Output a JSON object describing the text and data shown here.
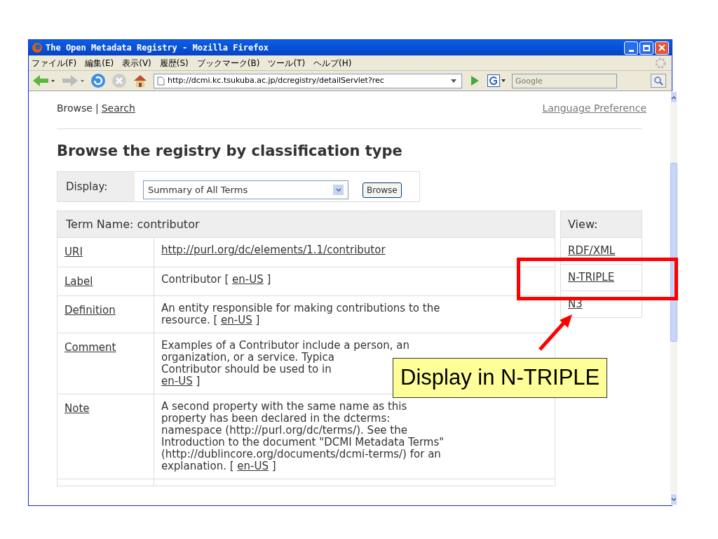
{
  "window": {
    "title": "The Open Metadata Registry - Mozilla Firefox"
  },
  "menu": [
    "ファイル(F)",
    "編集(E)",
    "表示(V)",
    "履歴(S)",
    "ブックマーク(B)",
    "ツール(T)",
    "ヘルプ(H)"
  ],
  "toolbar": {
    "url": "http://dcmi.kc.tsukuba.ac.jp/dcregistry/detailServlet?rec",
    "search_placeholder": "Google"
  },
  "nav": {
    "links": [
      {
        "text": "Browse",
        "link": false
      },
      {
        "text": "Search",
        "link": true
      }
    ],
    "separator": "|",
    "language": "Language Preference"
  },
  "heading": "Browse the registry by classification type",
  "display": {
    "label": "Display:",
    "value": "Summary of All Terms",
    "button": "Browse"
  },
  "table": {
    "header": "Term Name: contributor",
    "rows": [
      {
        "name": "URI",
        "lines": [
          [
            {
              "kind": "link",
              "text": "http://purl.org/dc/elements/1.1/contributor"
            }
          ]
        ]
      },
      {
        "name": "Label",
        "lines": [
          [
            {
              "kind": "text",
              "text": "Contributor [ "
            },
            {
              "kind": "link",
              "text": "en-US"
            },
            {
              "kind": "text",
              "text": " ]"
            }
          ]
        ]
      },
      {
        "name": "Definition",
        "lines": [
          [
            {
              "kind": "text",
              "text": "An entity responsible for making contributions to the"
            }
          ],
          [
            {
              "kind": "text",
              "text": "resource. [ "
            },
            {
              "kind": "link",
              "text": "en-US"
            },
            {
              "kind": "text",
              "text": " ]"
            }
          ]
        ]
      },
      {
        "name": "Comment",
        "lines": [
          [
            {
              "kind": "text",
              "text": "Examples of a Contributor include a person, an"
            }
          ],
          [
            {
              "kind": "text",
              "text": "organization, or a service. Typica"
            }
          ],
          [
            {
              "kind": "text",
              "text": "Contributor should be used to in"
            }
          ],
          [
            {
              "kind": "link",
              "text": "en-US"
            },
            {
              "kind": "text",
              "text": " ]"
            }
          ]
        ]
      },
      {
        "name": "Note",
        "lines": [
          [
            {
              "kind": "text",
              "text": "A second property with the same name as this"
            }
          ],
          [
            {
              "kind": "text",
              "text": "property has been declared in the dcterms:"
            }
          ],
          [
            {
              "kind": "text",
              "text": "namespace (http://purl.org/dc/terms/). See the"
            }
          ],
          [
            {
              "kind": "text",
              "text": "Introduction to the document \"DCMI Metadata Terms\""
            }
          ],
          [
            {
              "kind": "text",
              "text": "(http://dublincore.org/documents/dcmi-terms/) for an"
            }
          ],
          [
            {
              "kind": "text",
              "text": "explanation. [ "
            },
            {
              "kind": "link",
              "text": "en-US"
            },
            {
              "kind": "text",
              "text": " ]"
            }
          ]
        ]
      }
    ]
  },
  "view": {
    "header": "View:",
    "links": [
      "RDF/XML",
      "N-TRIPLE",
      "N3"
    ]
  },
  "annotation": {
    "text": "Display in N-TRIPLE"
  }
}
